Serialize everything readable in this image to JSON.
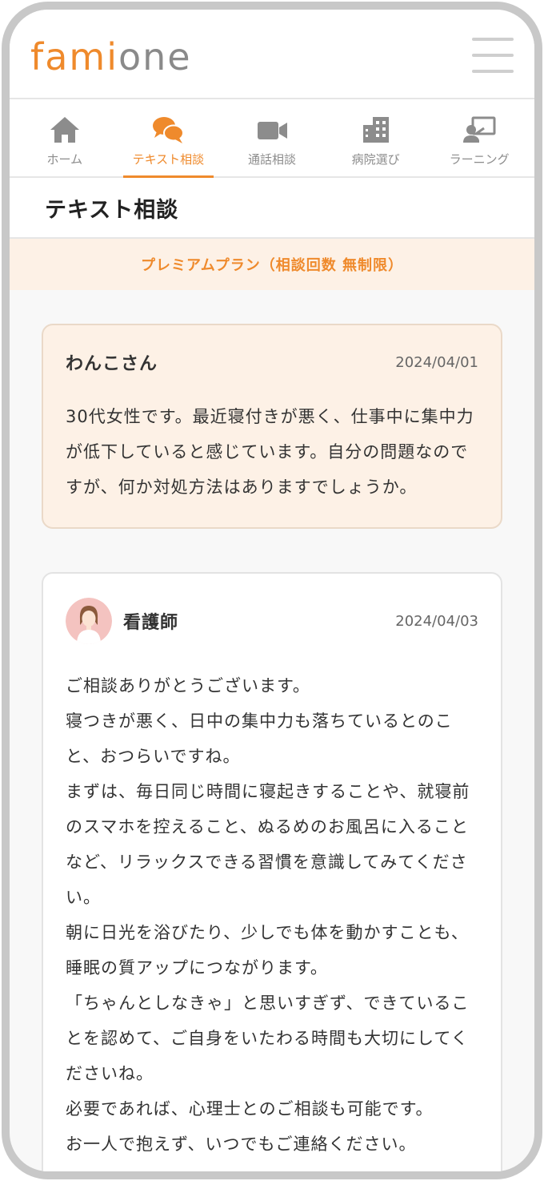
{
  "app": {
    "logo_part1": "fami",
    "logo_part2": "one"
  },
  "colors": {
    "accent": "#ef8a2c",
    "icon_gray": "#8c8c8c",
    "banner_bg": "#fdf1e6"
  },
  "tabs": [
    {
      "label": "ホーム",
      "icon": "home-icon"
    },
    {
      "label": "テキスト相談",
      "icon": "chat-bubbles-icon",
      "active": true
    },
    {
      "label": "通話相談",
      "icon": "video-camera-icon"
    },
    {
      "label": "病院選び",
      "icon": "hospital-icon"
    },
    {
      "label": "ラーニング",
      "icon": "learning-icon"
    }
  ],
  "page": {
    "title": "テキスト相談",
    "plan_banner": "プレミアムプラン（相談回数 無制限）"
  },
  "question": {
    "name": "わんこさん",
    "date": "2024/04/01",
    "body": "30代女性です。最近寝付きが悪く、仕事中に集中力が低下していると感じています。自分の問題なのですが、何か対処方法はありますでしょうか。"
  },
  "answer": {
    "name": "看護師",
    "date": "2024/04/03",
    "paragraphs": [
      "ご相談ありがとうございます。",
      "寝つきが悪く、日中の集中力も落ちているとのこと、おつらいですね。",
      "まずは、毎日同じ時間に寝起きすることや、就寝前のスマホを控えること、ぬるめのお風呂に入ることなど、リラックスできる習慣を意識してみてください。",
      "朝に日光を浴びたり、少しでも体を動かすことも、睡眠の質アップにつながります。",
      "「ちゃんとしなきゃ」と思いすぎず、できていることを認めて、ご自身をいたわる時間も大切にしてくださいね。",
      "必要であれば、心理士とのご相談も可能です。",
      "お一人で抱えず、いつでもご連絡ください。"
    ]
  }
}
